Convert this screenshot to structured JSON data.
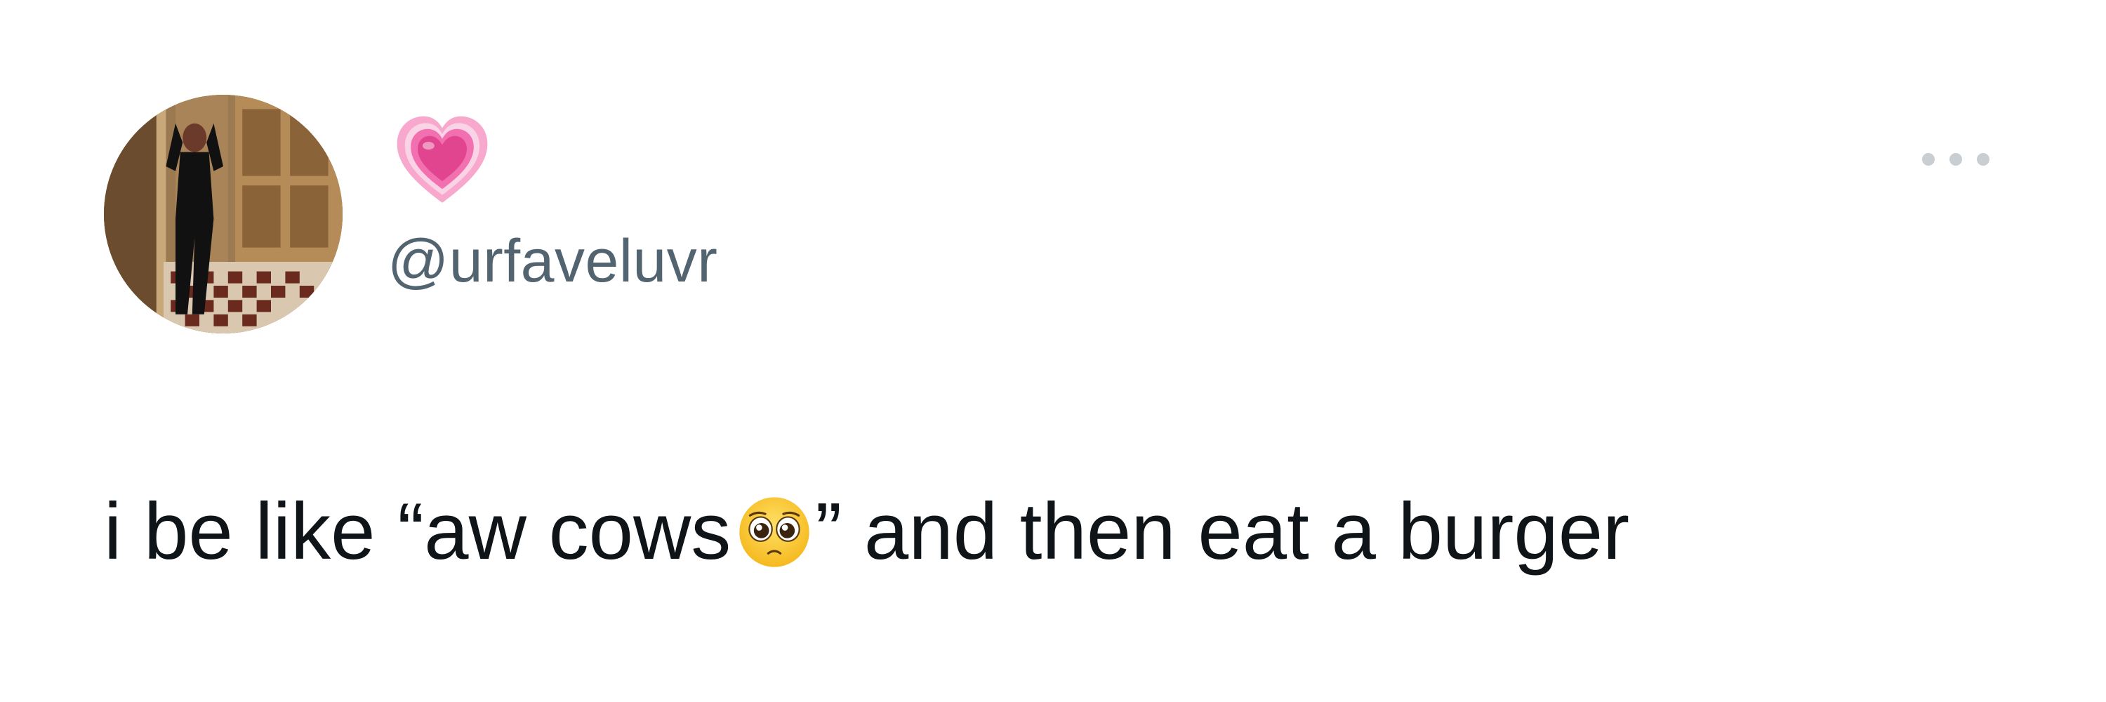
{
  "tweet": {
    "author": {
      "display_name_icon": "growing-heart-emoji",
      "handle": "@urfaveluvr",
      "avatar_icon": "profile-photo"
    },
    "more_icon": "more-options-icon",
    "text": {
      "before_emoji": "i be like “aw cows",
      "emoji": "pleading-face-emoji",
      "after_emoji": "” and then eat a burger"
    }
  },
  "colors": {
    "text": "#0f1419",
    "handle": "#536471",
    "more_dots": "#c9ced3",
    "heart": "#f06ea9"
  }
}
